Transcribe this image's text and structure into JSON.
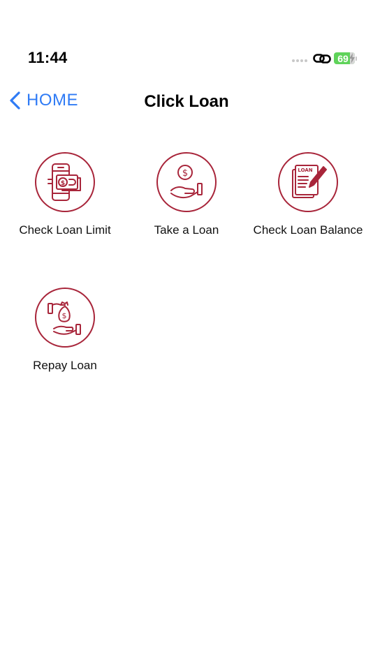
{
  "status_bar": {
    "time": "11:44",
    "battery_level": "69",
    "icons": [
      "signal-dots-icon",
      "link-icon",
      "battery-charging-icon"
    ]
  },
  "nav": {
    "back_label": "HOME",
    "title": "Click Loan"
  },
  "menu": {
    "items": [
      {
        "label": "Check Loan Limit",
        "icon": "phone-cash-icon"
      },
      {
        "label": "Take a Loan",
        "icon": "hand-coin-icon"
      },
      {
        "label": "Check Loan Balance",
        "icon": "loan-document-pen-icon"
      },
      {
        "label": "Repay Loan",
        "icon": "money-bag-hand-icon"
      }
    ]
  },
  "colors": {
    "accent": "#2f7bf5",
    "icon_stroke": "#a8253a",
    "battery": "#5fd35a"
  }
}
